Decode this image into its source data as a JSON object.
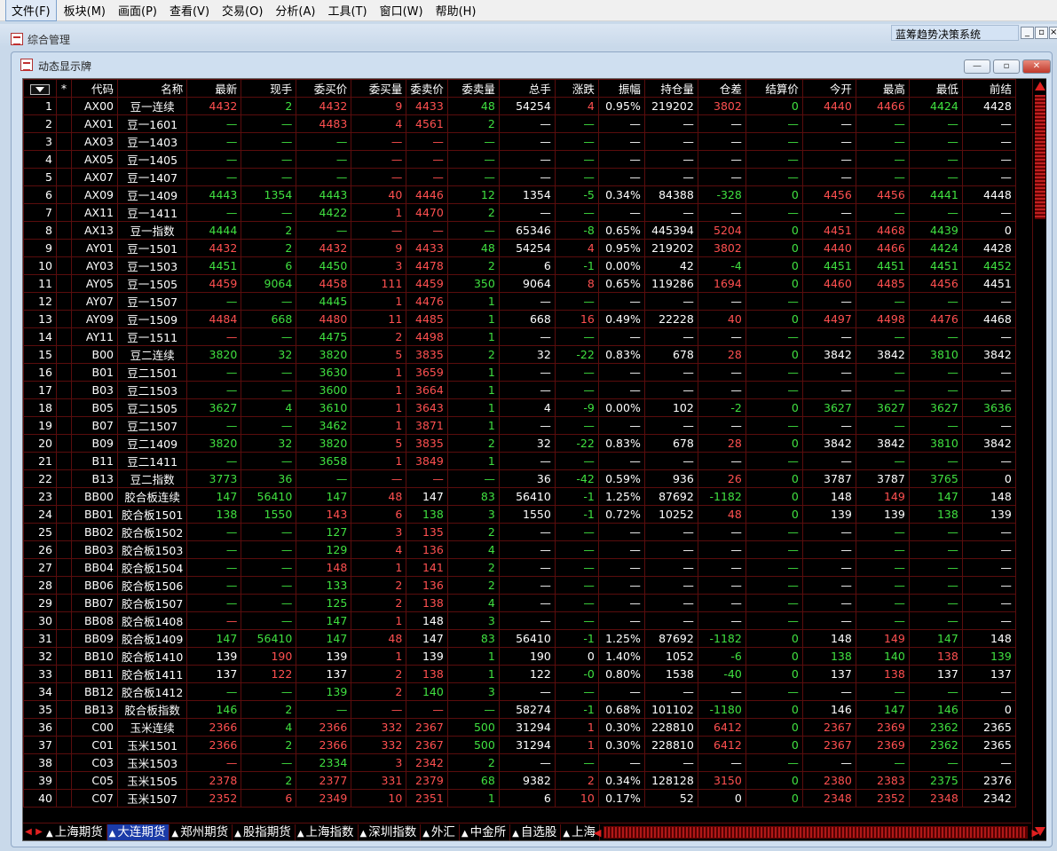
{
  "menu": [
    {
      "id": "file",
      "label": "文件(F)",
      "active": true
    },
    {
      "id": "sector",
      "label": "板块(M)"
    },
    {
      "id": "view",
      "label": "画面(P)"
    },
    {
      "id": "lookup",
      "label": "查看(V)"
    },
    {
      "id": "trade",
      "label": "交易(O)"
    },
    {
      "id": "analyze",
      "label": "分析(A)"
    },
    {
      "id": "tools",
      "label": "工具(T)"
    },
    {
      "id": "window",
      "label": "窗口(W)"
    },
    {
      "id": "help",
      "label": "帮助(H)"
    }
  ],
  "mdi": {
    "title": "综合管理",
    "app_title": "蓝筹趋势决策系统",
    "min": "_",
    "restore": "▫",
    "close": "×"
  },
  "window": {
    "title": "动态显示牌",
    "min": "—",
    "restore": "▫",
    "close": "✕"
  },
  "table": {
    "headers": [
      "*",
      "代码",
      "名称",
      "最新",
      "现手",
      "委买价",
      "委买量",
      "委卖价",
      "委卖量",
      "总手",
      "涨跌",
      "振幅",
      "持仓量",
      "仓差",
      "结算价",
      "今开",
      "最高",
      "最低",
      "前结"
    ],
    "rows": [
      {
        "cells": [
          "1",
          "AX00",
          "豆一连续",
          "4432",
          "2",
          "4432",
          "9",
          "4433",
          "48",
          "54254",
          "4",
          "0.95%",
          "219202",
          "3802",
          "0",
          "4440",
          "4466",
          "4424",
          "4428"
        ],
        "c": "wwwrgrrrgwrwwrgrrgw"
      },
      {
        "cells": [
          "2",
          "AX01",
          "豆一1601",
          "—",
          "—",
          "4483",
          "4",
          "4561",
          "2",
          "—",
          "—",
          "—",
          "—",
          "—",
          "—",
          "—",
          "—",
          "—",
          "—"
        ],
        "c": "wwwggrrrgwgwwwgwggw"
      },
      {
        "cells": [
          "3",
          "AX03",
          "豆一1403",
          "—",
          "—",
          "—",
          "—",
          "—",
          "—",
          "—",
          "—",
          "—",
          "—",
          "—",
          "—",
          "—",
          "—",
          "—",
          "—"
        ],
        "c": "wwwgggrrgwgwwwgwggw"
      },
      {
        "cells": [
          "4",
          "AX05",
          "豆一1405",
          "—",
          "—",
          "—",
          "—",
          "—",
          "—",
          "—",
          "—",
          "—",
          "—",
          "—",
          "—",
          "—",
          "—",
          "—",
          "—"
        ],
        "c": "wwwgggrrgwgwwwgwggw"
      },
      {
        "cells": [
          "5",
          "AX07",
          "豆一1407",
          "—",
          "—",
          "—",
          "—",
          "—",
          "—",
          "—",
          "—",
          "—",
          "—",
          "—",
          "—",
          "—",
          "—",
          "—",
          "—"
        ],
        "c": "wwwgggrrgwgwwwgwggw"
      },
      {
        "cells": [
          "6",
          "AX09",
          "豆一1409",
          "4443",
          "1354",
          "4443",
          "40",
          "4446",
          "12",
          "1354",
          "-5",
          "0.34%",
          "84388",
          "-328",
          "0",
          "4456",
          "4456",
          "4441",
          "4448"
        ],
        "c": "wwwgggrrgwgwwggrrgw"
      },
      {
        "cells": [
          "7",
          "AX11",
          "豆一1411",
          "—",
          "—",
          "4422",
          "1",
          "4470",
          "2",
          "—",
          "—",
          "—",
          "—",
          "—",
          "—",
          "—",
          "—",
          "—",
          "—"
        ],
        "c": "wwwgggrrgwgwwwgwggw"
      },
      {
        "cells": [
          "8",
          "AX13",
          "豆一指数",
          "4444",
          "2",
          "—",
          "—",
          "—",
          "—",
          "65346",
          "-8",
          "0.65%",
          "445394",
          "5204",
          "0",
          "4451",
          "4468",
          "4439",
          "0"
        ],
        "c": "wwwgggrrgwgwwrgrrgw"
      },
      {
        "cells": [
          "9",
          "AY01",
          "豆一1501",
          "4432",
          "2",
          "4432",
          "9",
          "4433",
          "48",
          "54254",
          "4",
          "0.95%",
          "219202",
          "3802",
          "0",
          "4440",
          "4466",
          "4424",
          "4428"
        ],
        "c": "wwwrgrrrgwrwwrgrrgw"
      },
      {
        "cells": [
          "10",
          "AY03",
          "豆一1503",
          "4451",
          "6",
          "4450",
          "3",
          "4478",
          "2",
          "6",
          "-1",
          "0.00%",
          "42",
          "-4",
          "0",
          "4451",
          "4451",
          "4451",
          "4452"
        ],
        "c": "wwwgggrrgwgwwggggggw"
      },
      {
        "cells": [
          "11",
          "AY05",
          "豆一1505",
          "4459",
          "9064",
          "4458",
          "111",
          "4459",
          "350",
          "9064",
          "8",
          "0.65%",
          "119286",
          "1694",
          "0",
          "4460",
          "4485",
          "4456",
          "4451"
        ],
        "c": "wwwrgrrrgwrwwrgrrrw"
      },
      {
        "cells": [
          "12",
          "AY07",
          "豆一1507",
          "—",
          "—",
          "4445",
          "1",
          "4476",
          "1",
          "—",
          "—",
          "—",
          "—",
          "—",
          "—",
          "—",
          "—",
          "—",
          "—"
        ],
        "c": "wwwgggrrgwgwwwgwggw"
      },
      {
        "cells": [
          "13",
          "AY09",
          "豆一1509",
          "4484",
          "668",
          "4480",
          "11",
          "4485",
          "1",
          "668",
          "16",
          "0.49%",
          "22228",
          "40",
          "0",
          "4497",
          "4498",
          "4476",
          "4468"
        ],
        "c": "wwwrgrrrgwrwwrgrrrw"
      },
      {
        "cells": [
          "14",
          "AY11",
          "豆一1511",
          "—",
          "—",
          "4475",
          "2",
          "4498",
          "1",
          "—",
          "—",
          "—",
          "—",
          "—",
          "—",
          "—",
          "—",
          "—",
          "—"
        ],
        "c": "wwwrggrrgwgwwwgwggw"
      },
      {
        "cells": [
          "15",
          "B00",
          "豆二连续",
          "3820",
          "32",
          "3820",
          "5",
          "3835",
          "2",
          "32",
          "-22",
          "0.83%",
          "678",
          "28",
          "0",
          "3842",
          "3842",
          "3810",
          "3842"
        ],
        "c": "wwwgggrrgwgwwrgwwgw"
      },
      {
        "cells": [
          "16",
          "B01",
          "豆二1501",
          "—",
          "—",
          "3630",
          "1",
          "3659",
          "1",
          "—",
          "—",
          "—",
          "—",
          "—",
          "—",
          "—",
          "—",
          "—",
          "—"
        ],
        "c": "wwwgggrrgwgwwwgwggw"
      },
      {
        "cells": [
          "17",
          "B03",
          "豆二1503",
          "—",
          "—",
          "3600",
          "1",
          "3664",
          "1",
          "—",
          "—",
          "—",
          "—",
          "—",
          "—",
          "—",
          "—",
          "—",
          "—"
        ],
        "c": "wwwgggrrgwgwwwgwggw"
      },
      {
        "cells": [
          "18",
          "B05",
          "豆二1505",
          "3627",
          "4",
          "3610",
          "1",
          "3643",
          "1",
          "4",
          "-9",
          "0.00%",
          "102",
          "-2",
          "0",
          "3627",
          "3627",
          "3627",
          "3636"
        ],
        "c": "wwwgggrrgwgwwggggggw"
      },
      {
        "cells": [
          "19",
          "B07",
          "豆二1507",
          "—",
          "—",
          "3462",
          "1",
          "3871",
          "1",
          "—",
          "—",
          "—",
          "—",
          "—",
          "—",
          "—",
          "—",
          "—",
          "—"
        ],
        "c": "wwwgggrrgwgwwwgwggw"
      },
      {
        "cells": [
          "20",
          "B09",
          "豆二1409",
          "3820",
          "32",
          "3820",
          "5",
          "3835",
          "2",
          "32",
          "-22",
          "0.83%",
          "678",
          "28",
          "0",
          "3842",
          "3842",
          "3810",
          "3842"
        ],
        "c": "wwwgggrrgwgwwrgwwgw"
      },
      {
        "cells": [
          "21",
          "B11",
          "豆二1411",
          "—",
          "—",
          "3658",
          "1",
          "3849",
          "1",
          "—",
          "—",
          "—",
          "—",
          "—",
          "—",
          "—",
          "—",
          "—",
          "—"
        ],
        "c": "wwwgggrrgwgwwwgwggw"
      },
      {
        "cells": [
          "22",
          "B13",
          "豆二指数",
          "3773",
          "36",
          "—",
          "—",
          "—",
          "—",
          "36",
          "-42",
          "0.59%",
          "936",
          "26",
          "0",
          "3787",
          "3787",
          "3765",
          "0"
        ],
        "c": "wwwgggrrgwgwwrgwwgw"
      },
      {
        "cells": [
          "23",
          "BB00",
          "胶合板连续",
          "147",
          "56410",
          "147",
          "48",
          "147",
          "83",
          "56410",
          "-1",
          "1.25%",
          "87692",
          "-1182",
          "0",
          "148",
          "149",
          "147",
          "148"
        ],
        "c": "wwwgggrwgwgwwggwrgw"
      },
      {
        "cells": [
          "24",
          "BB01",
          "胶合板1501",
          "138",
          "1550",
          "143",
          "6",
          "138",
          "3",
          "1550",
          "-1",
          "0.72%",
          "10252",
          "48",
          "0",
          "139",
          "139",
          "138",
          "139"
        ],
        "c": "wwwggrrggwgwwrgwwgw"
      },
      {
        "cells": [
          "25",
          "BB02",
          "胶合板1502",
          "—",
          "—",
          "127",
          "3",
          "135",
          "2",
          "—",
          "—",
          "—",
          "—",
          "—",
          "—",
          "—",
          "—",
          "—",
          "—"
        ],
        "c": "wwwgggrrgwgwwwgwggw"
      },
      {
        "cells": [
          "26",
          "BB03",
          "胶合板1503",
          "—",
          "—",
          "129",
          "4",
          "136",
          "4",
          "—",
          "—",
          "—",
          "—",
          "—",
          "—",
          "—",
          "—",
          "—",
          "—"
        ],
        "c": "wwwgggrrgwgwwwgwggw"
      },
      {
        "cells": [
          "27",
          "BB04",
          "胶合板1504",
          "—",
          "—",
          "148",
          "1",
          "141",
          "2",
          "—",
          "—",
          "—",
          "—",
          "—",
          "—",
          "—",
          "—",
          "—",
          "—"
        ],
        "c": "wwwggrrrgwgwwwgwggw"
      },
      {
        "cells": [
          "28",
          "BB06",
          "胶合板1506",
          "—",
          "—",
          "133",
          "2",
          "136",
          "2",
          "—",
          "—",
          "—",
          "—",
          "—",
          "—",
          "—",
          "—",
          "—",
          "—"
        ],
        "c": "wwwgggrrgwgwwwgwggw"
      },
      {
        "cells": [
          "29",
          "BB07",
          "胶合板1507",
          "—",
          "—",
          "125",
          "2",
          "138",
          "4",
          "—",
          "—",
          "—",
          "—",
          "—",
          "—",
          "—",
          "—",
          "—",
          "—"
        ],
        "c": "wwwgggrrgwgwwwgwggw"
      },
      {
        "cells": [
          "30",
          "BB08",
          "胶合板1408",
          "—",
          "—",
          "147",
          "1",
          "148",
          "3",
          "—",
          "—",
          "—",
          "—",
          "—",
          "—",
          "—",
          "—",
          "—",
          "—"
        ],
        "c": "wwwrggrwgwgwwwgwggw"
      },
      {
        "cells": [
          "31",
          "BB09",
          "胶合板1409",
          "147",
          "56410",
          "147",
          "48",
          "147",
          "83",
          "56410",
          "-1",
          "1.25%",
          "87692",
          "-1182",
          "0",
          "148",
          "149",
          "147",
          "148"
        ],
        "c": "wwwgggrwgwgwwggwrgw"
      },
      {
        "cells": [
          "32",
          "BB10",
          "胶合板1410",
          "139",
          "190",
          "139",
          "1",
          "139",
          "1",
          "190",
          "0",
          "1.40%",
          "1052",
          "-6",
          "0",
          "138",
          "140",
          "138",
          "139"
        ],
        "c": "wwwwrwrwgwwwwggggrgw"
      },
      {
        "cells": [
          "33",
          "BB11",
          "胶合板1411",
          "137",
          "122",
          "137",
          "2",
          "138",
          "1",
          "122",
          "-0",
          "0.80%",
          "1538",
          "-40",
          "0",
          "137",
          "138",
          "137",
          "137"
        ],
        "c": "wwwwrwrrgwgwwggwrww"
      },
      {
        "cells": [
          "34",
          "BB12",
          "胶合板1412",
          "—",
          "—",
          "139",
          "2",
          "140",
          "3",
          "—",
          "—",
          "—",
          "—",
          "—",
          "—",
          "—",
          "—",
          "—",
          "—"
        ],
        "c": "wwwgggrggwgwwwgwggw"
      },
      {
        "cells": [
          "35",
          "BB13",
          "胶合板指数",
          "146",
          "2",
          "—",
          "—",
          "—",
          "—",
          "58274",
          "-1",
          "0.68%",
          "101102",
          "-1180",
          "0",
          "146",
          "147",
          "146",
          "0"
        ],
        "c": "wwwgggrrgwgwwggwggw"
      },
      {
        "cells": [
          "36",
          "C00",
          "玉米连续",
          "2366",
          "4",
          "2366",
          "332",
          "2367",
          "500",
          "31294",
          "1",
          "0.30%",
          "228810",
          "6412",
          "0",
          "2367",
          "2369",
          "2362",
          "2365"
        ],
        "c": "wwwrgrrrgwrwwrgrrgw"
      },
      {
        "cells": [
          "37",
          "C01",
          "玉米1501",
          "2366",
          "2",
          "2366",
          "332",
          "2367",
          "500",
          "31294",
          "1",
          "0.30%",
          "228810",
          "6412",
          "0",
          "2367",
          "2369",
          "2362",
          "2365"
        ],
        "c": "wwwrgrrrgwrwwrgrrgw"
      },
      {
        "cells": [
          "38",
          "C03",
          "玉米1503",
          "—",
          "—",
          "2334",
          "3",
          "2342",
          "2",
          "—",
          "—",
          "—",
          "—",
          "—",
          "—",
          "—",
          "—",
          "—",
          "—"
        ],
        "c": "wwwrggrrgwgwwwgwggw"
      },
      {
        "cells": [
          "39",
          "C05",
          "玉米1505",
          "2378",
          "2",
          "2377",
          "331",
          "2379",
          "68",
          "9382",
          "2",
          "0.34%",
          "128128",
          "3150",
          "0",
          "2380",
          "2383",
          "2375",
          "2376"
        ],
        "c": "wwwrgrrrgwrwwrgrrgw"
      },
      {
        "cells": [
          "40",
          "C07",
          "玉米1507",
          "2352",
          "6",
          "2349",
          "10",
          "2351",
          "1",
          "6",
          "10",
          "0.17%",
          "52",
          "0",
          "0",
          "2348",
          "2352",
          "2348",
          "2342"
        ],
        "c": "wwwrrrrrgwrwwwgrrrw"
      }
    ]
  },
  "tabs": [
    {
      "label": "上海期货"
    },
    {
      "label": "大连期货",
      "active": true
    },
    {
      "label": "郑州期货"
    },
    {
      "label": "股指期货"
    },
    {
      "label": "上海指数"
    },
    {
      "label": "深圳指数"
    },
    {
      "label": "外汇"
    },
    {
      "label": "中金所"
    },
    {
      "label": "自选股"
    },
    {
      "label": "上海"
    }
  ],
  "colors": {
    "up": "#ff5050",
    "down": "#40e040",
    "flat": "#ffffff",
    "grid": "#5a0d0d",
    "bg": "#000000",
    "active_tab": "#1b3ba8"
  }
}
